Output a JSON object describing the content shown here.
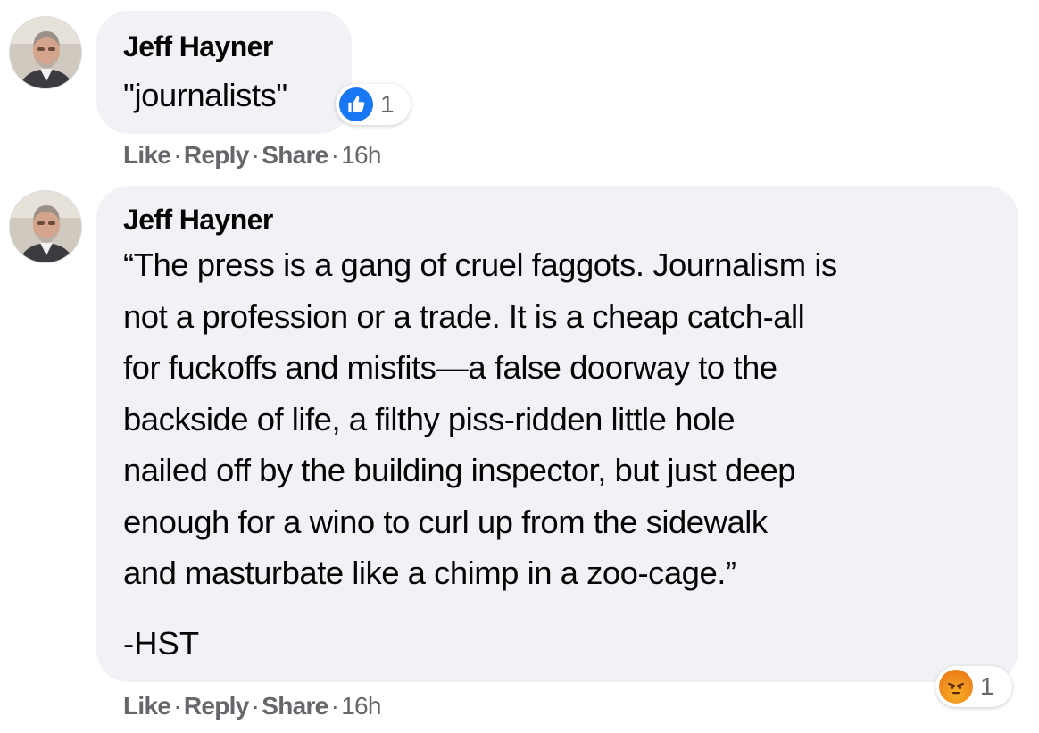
{
  "comments": [
    {
      "author": "Jeff Hayner",
      "text": "\"journalists\"",
      "reaction": {
        "icon": "like-icon",
        "count": "1",
        "color": "#1877f2"
      },
      "actions": {
        "like": "Like",
        "reply": "Reply",
        "share": "Share",
        "time": "16h",
        "separator": "·"
      }
    },
    {
      "author": "Jeff Hayner",
      "lines": [
        "“The press is a gang of cruel faggots. Journalism is",
        "not a profession or a trade. It is a cheap catch-all",
        "for fuckoffs and misfits—a false doorway to the",
        "backside of life, a filthy piss-ridden little hole",
        "nailed off by the building inspector, but just deep",
        "enough for a wino to curl up from the sidewalk",
        "and masturbate like a chimp in a zoo-cage.”"
      ],
      "signature": "-HST",
      "reaction": {
        "icon": "angry-icon",
        "count": "1",
        "color": "#e9710f"
      },
      "actions": {
        "like": "Like",
        "reply": "Reply",
        "share": "Share",
        "time": "16h",
        "separator": "·"
      }
    }
  ]
}
